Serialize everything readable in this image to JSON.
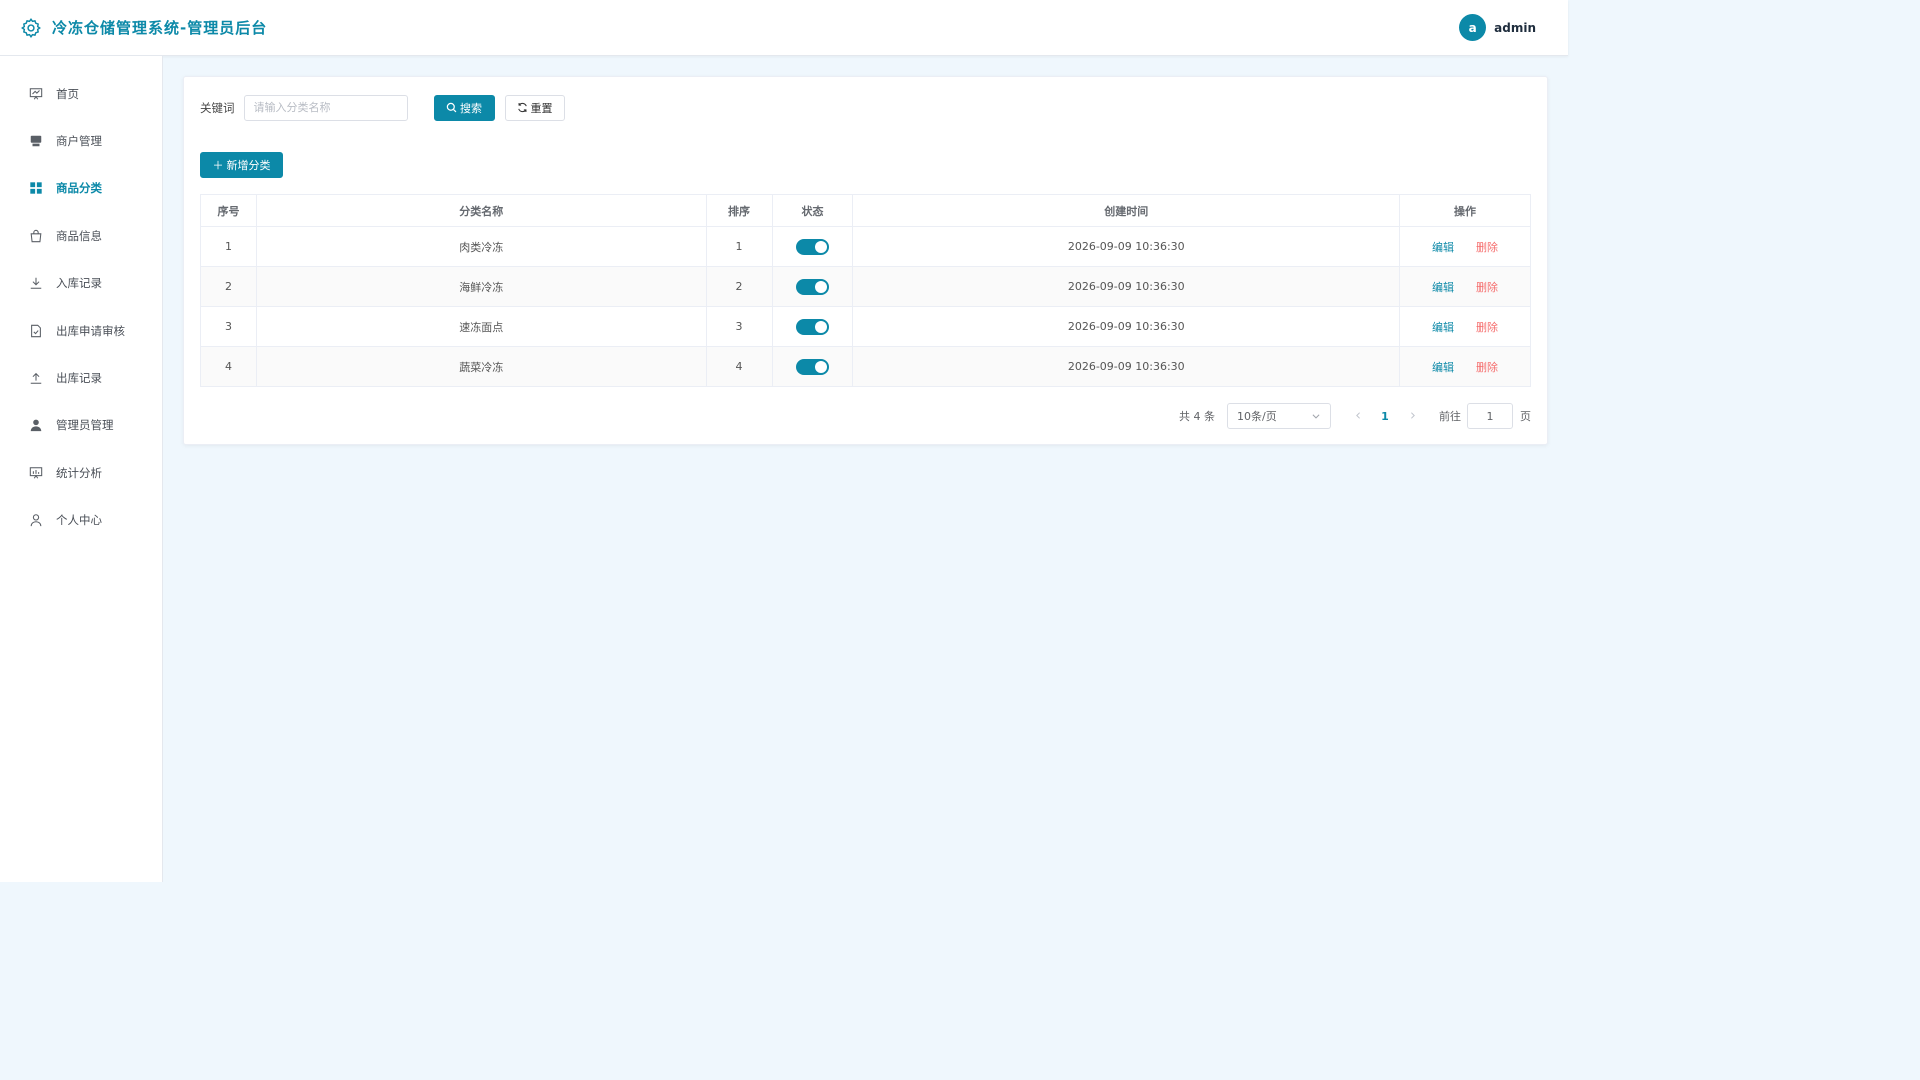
{
  "header": {
    "title": "冷冻仓储管理系统-管理员后台",
    "avatar_letter": "a",
    "username": "admin"
  },
  "sidebar": {
    "items": [
      {
        "label": "首页",
        "icon": "dashboard-icon"
      },
      {
        "label": "商户管理",
        "icon": "shop-icon"
      },
      {
        "label": "商品分类",
        "icon": "grid-icon",
        "active": true
      },
      {
        "label": "商品信息",
        "icon": "bag-icon"
      },
      {
        "label": "入库记录",
        "icon": "download-icon"
      },
      {
        "label": "出库申请审核",
        "icon": "doc-check-icon"
      },
      {
        "label": "出库记录",
        "icon": "upload-icon"
      },
      {
        "label": "管理员管理",
        "icon": "user-filled-icon"
      },
      {
        "label": "统计分析",
        "icon": "chart-icon"
      },
      {
        "label": "个人中心",
        "icon": "user-icon"
      }
    ]
  },
  "search": {
    "label": "关键词",
    "placeholder": "请输入分类名称",
    "search_btn": "搜索",
    "reset_btn": "重置"
  },
  "toolbar": {
    "add_btn": "新增分类"
  },
  "table": {
    "headers": [
      "序号",
      "分类名称",
      "排序",
      "状态",
      "创建时间",
      "操作"
    ],
    "rows": [
      {
        "index": "1",
        "name": "肉类冷冻",
        "sort": "1",
        "status": true,
        "created": "2026-09-09 10:36:30"
      },
      {
        "index": "2",
        "name": "海鲜冷冻",
        "sort": "2",
        "status": true,
        "created": "2026-09-09 10:36:30"
      },
      {
        "index": "3",
        "name": "速冻面点",
        "sort": "3",
        "status": true,
        "created": "2026-09-09 10:36:30"
      },
      {
        "index": "4",
        "name": "蔬菜冷冻",
        "sort": "4",
        "status": true,
        "created": "2026-09-09 10:36:30"
      }
    ],
    "edit_label": "编辑",
    "delete_label": "删除"
  },
  "pagination": {
    "total_text": "共 4 条",
    "page_size": "10条/页",
    "current_page": "1",
    "goto_label": "前往",
    "goto_value": "1",
    "page_suffix": "页"
  },
  "colors": {
    "primary": "#0c89a8",
    "danger": "#f56c6c"
  }
}
